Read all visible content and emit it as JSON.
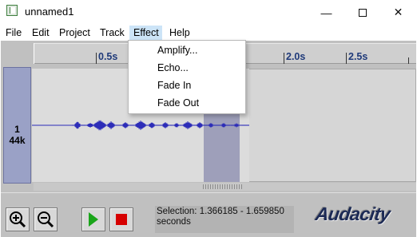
{
  "window": {
    "title": "unnamed1",
    "minimize_glyph": "—",
    "close_glyph": "✕"
  },
  "menubar": {
    "items": [
      "File",
      "Edit",
      "Project",
      "Track",
      "Effect",
      "Help"
    ],
    "active": "Effect"
  },
  "effect_menu": {
    "items": [
      "Amplify...",
      "Echo...",
      "Fade In",
      "Fade Out"
    ]
  },
  "ruler": {
    "labels": [
      "0.5s",
      "2.0s",
      "2.5s"
    ]
  },
  "track": {
    "number": "1",
    "rate": "44k"
  },
  "status": {
    "selection_text": "Selection: 1.366185 - 1.659850 seconds"
  },
  "logo": {
    "text": "Audacity"
  },
  "colors": {
    "waveform": "#2d2db8",
    "selection": "#9e9fba",
    "play": "#1aa51a",
    "stop": "#d60000",
    "menu_highlight": "#cce4f7"
  },
  "icons": [
    "app-icon",
    "zoom-in-icon",
    "zoom-out-icon",
    "play-icon",
    "stop-icon"
  ]
}
